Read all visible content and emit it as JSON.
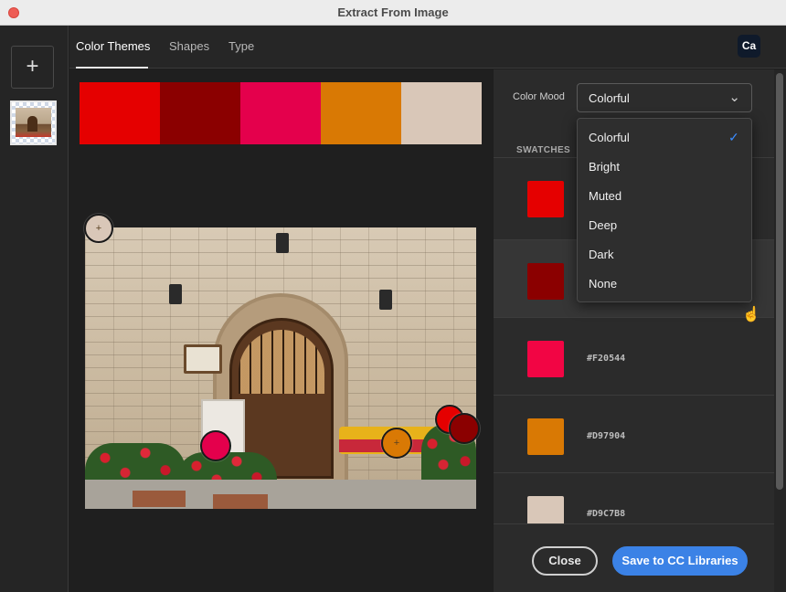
{
  "window": {
    "title": "Extract From Image"
  },
  "left_rail": {
    "add_label": "+"
  },
  "tabs": [
    {
      "label": "Color Themes",
      "active": true
    },
    {
      "label": "Shapes",
      "active": false
    },
    {
      "label": "Type",
      "active": false
    }
  ],
  "app_badge": "Ca",
  "palette": [
    "#E50000",
    "#8B0000",
    "#E4004C",
    "#D97904",
    "#D9C7B8"
  ],
  "mood": {
    "label": "Color Mood",
    "value": "Colorful",
    "options": [
      "Colorful",
      "Bright",
      "Muted",
      "Deep",
      "Dark",
      "None"
    ],
    "checked": "Colorful"
  },
  "swatches": {
    "header": "SWATCHES",
    "items": [
      {
        "color": "#E50000",
        "hex": ""
      },
      {
        "color": "#8B0000",
        "hex": ""
      },
      {
        "color": "#F20544",
        "hex": "#F20544"
      },
      {
        "color": "#D97904",
        "hex": "#D97904"
      },
      {
        "color": "#D9C7B8",
        "hex": "#D9C7B8"
      }
    ]
  },
  "buttons": {
    "close": "Close",
    "save": "Save to CC Libraries"
  },
  "icons": {
    "add": "plus-icon",
    "chevron": "chevron-down-icon",
    "check": "checkmark-icon",
    "cursor": "hand-cursor-icon"
  }
}
